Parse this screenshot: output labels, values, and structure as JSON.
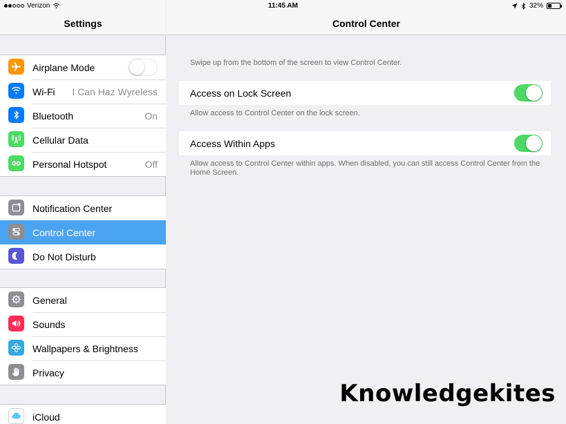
{
  "status_bar": {
    "carrier": "Verizon",
    "time": "11:45 AM",
    "battery": "32%",
    "battery_level": 0.32,
    "icons": [
      "signal-dots-icon",
      "wifi-icon",
      "location-arrow-icon",
      "bluetooth-icon",
      "battery-icon"
    ]
  },
  "sidebar": {
    "title": "Settings",
    "groups": [
      {
        "items": [
          {
            "label": "Airplane Mode",
            "icon": "airplane-icon",
            "color": "#ff9500",
            "toggle": "off"
          },
          {
            "label": "Wi-Fi",
            "value": "I Can Haz Wyreless",
            "icon": "wifi-icon",
            "color": "#007aff"
          },
          {
            "label": "Bluetooth",
            "value": "On",
            "icon": "bluetooth-icon",
            "color": "#007aff"
          },
          {
            "label": "Cellular Data",
            "icon": "cellular-icon",
            "color": "#4cd964"
          },
          {
            "label": "Personal Hotspot",
            "value": "Off",
            "icon": "hotspot-icon",
            "color": "#4cd964"
          }
        ]
      },
      {
        "items": [
          {
            "label": "Notification Center",
            "icon": "notification-center-icon",
            "color": "#8e8e93"
          },
          {
            "label": "Control Center",
            "icon": "control-center-icon",
            "color": "#8e8e93",
            "selected": true
          },
          {
            "label": "Do Not Disturb",
            "icon": "moon-icon",
            "color": "#5856d6"
          }
        ]
      },
      {
        "items": [
          {
            "label": "General",
            "icon": "gear-icon",
            "color": "#8e8e93"
          },
          {
            "label": "Sounds",
            "icon": "speaker-icon",
            "color": "#ff2d55"
          },
          {
            "label": "Wallpapers & Brightness",
            "icon": "flower-icon",
            "color": "#34aadc"
          },
          {
            "label": "Privacy",
            "icon": "hand-icon",
            "color": "#8e8e93"
          }
        ]
      },
      {
        "items": [
          {
            "label": "iCloud",
            "icon": "cloud-icon",
            "color": "#ffffff"
          }
        ]
      }
    ]
  },
  "main": {
    "title": "Control Center",
    "intro": "Swipe up from the bottom of the screen to view Control Center.",
    "lock_screen": {
      "label": "Access on Lock Screen",
      "toggle": "on",
      "footer": "Allow access to Control Center on the lock screen."
    },
    "within_apps": {
      "label": "Access Within Apps",
      "toggle": "on",
      "footer": "Allow access to Control Center within apps. When disabled, you can still access Control Center from the Home Screen."
    }
  },
  "watermark": "Knowledgekites",
  "colors": {
    "selected_row": "#4aa3f0",
    "toggle_on": "#4cd964",
    "background": "#efeff4"
  }
}
